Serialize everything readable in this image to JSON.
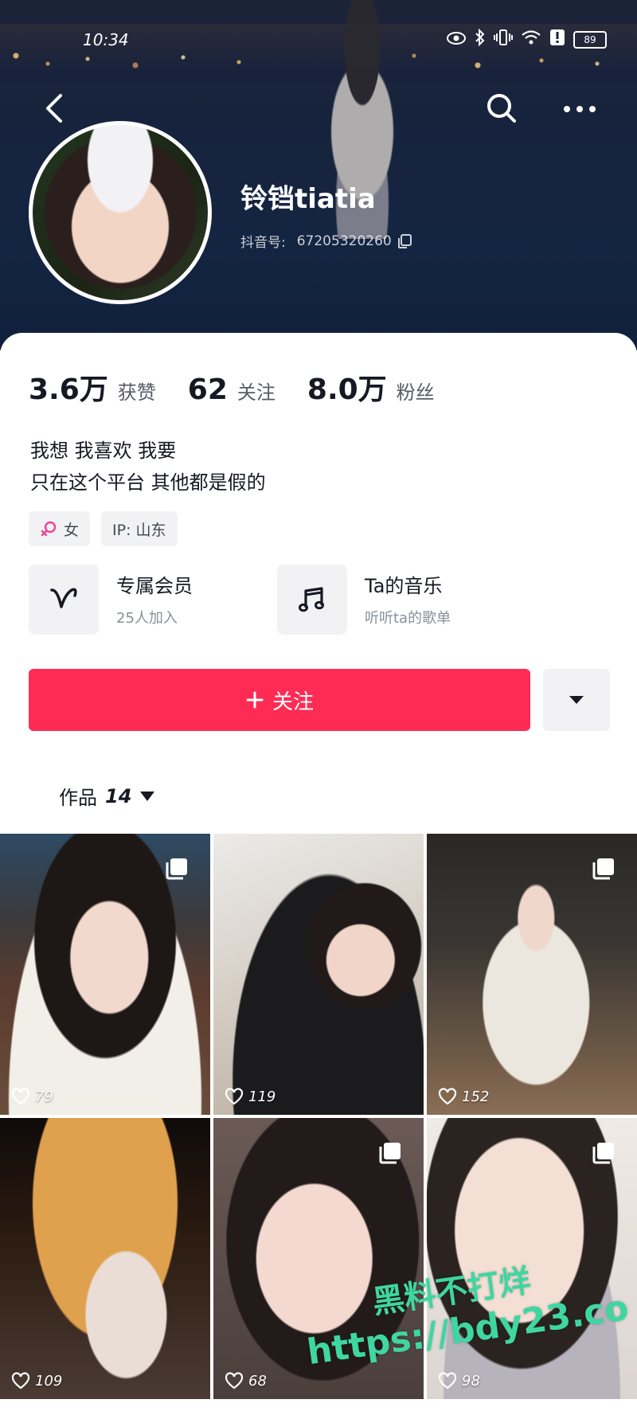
{
  "status_bar": {
    "time": "10:34",
    "battery": "89"
  },
  "profile": {
    "nickname": "铃铛tiatia",
    "douyin_id_label": "抖音号:",
    "douyin_id": "67205320260"
  },
  "stats": [
    {
      "value": "3.6万",
      "label": "获赞"
    },
    {
      "value": "62",
      "label": "关注"
    },
    {
      "value": "8.0万",
      "label": "粉丝"
    }
  ],
  "bio": {
    "line1": "我想 我喜欢 我要",
    "line2": "只在这个平台 其他都是假的"
  },
  "tags": {
    "gender": "女",
    "ip": "IP: 山东"
  },
  "features": {
    "member": {
      "title": "专属会员",
      "subtitle": "25人加入"
    },
    "music": {
      "title": "Ta的音乐",
      "subtitle": "听听ta的歌单"
    }
  },
  "actions": {
    "follow_label": "关注"
  },
  "works": {
    "label": "作品",
    "count": "14"
  },
  "grid": [
    {
      "likes": "79",
      "multi": true
    },
    {
      "likes": "119",
      "multi": false
    },
    {
      "likes": "152",
      "multi": true
    },
    {
      "likes": "109",
      "multi": false
    },
    {
      "likes": "68",
      "multi": true
    },
    {
      "likes": "98",
      "multi": true
    }
  ],
  "watermark": {
    "line1": "黑料不打烊",
    "line2": "https://bdy23.co"
  },
  "colors": {
    "accent": "#fe2c55",
    "header_bg": "#17233d",
    "gender_icon": "#e84a9a",
    "watermark": "#3fd6a2"
  },
  "icons": {
    "back": "chevron-left-icon",
    "search": "search-icon",
    "more": "more-dots-icon",
    "copy": "copy-icon",
    "member": "v-logo-icon",
    "music": "music-note-icon",
    "dropdown": "triangle-down-icon",
    "like": "heart-outline-icon",
    "multi": "multi-image-icon",
    "gender": "female-icon"
  }
}
